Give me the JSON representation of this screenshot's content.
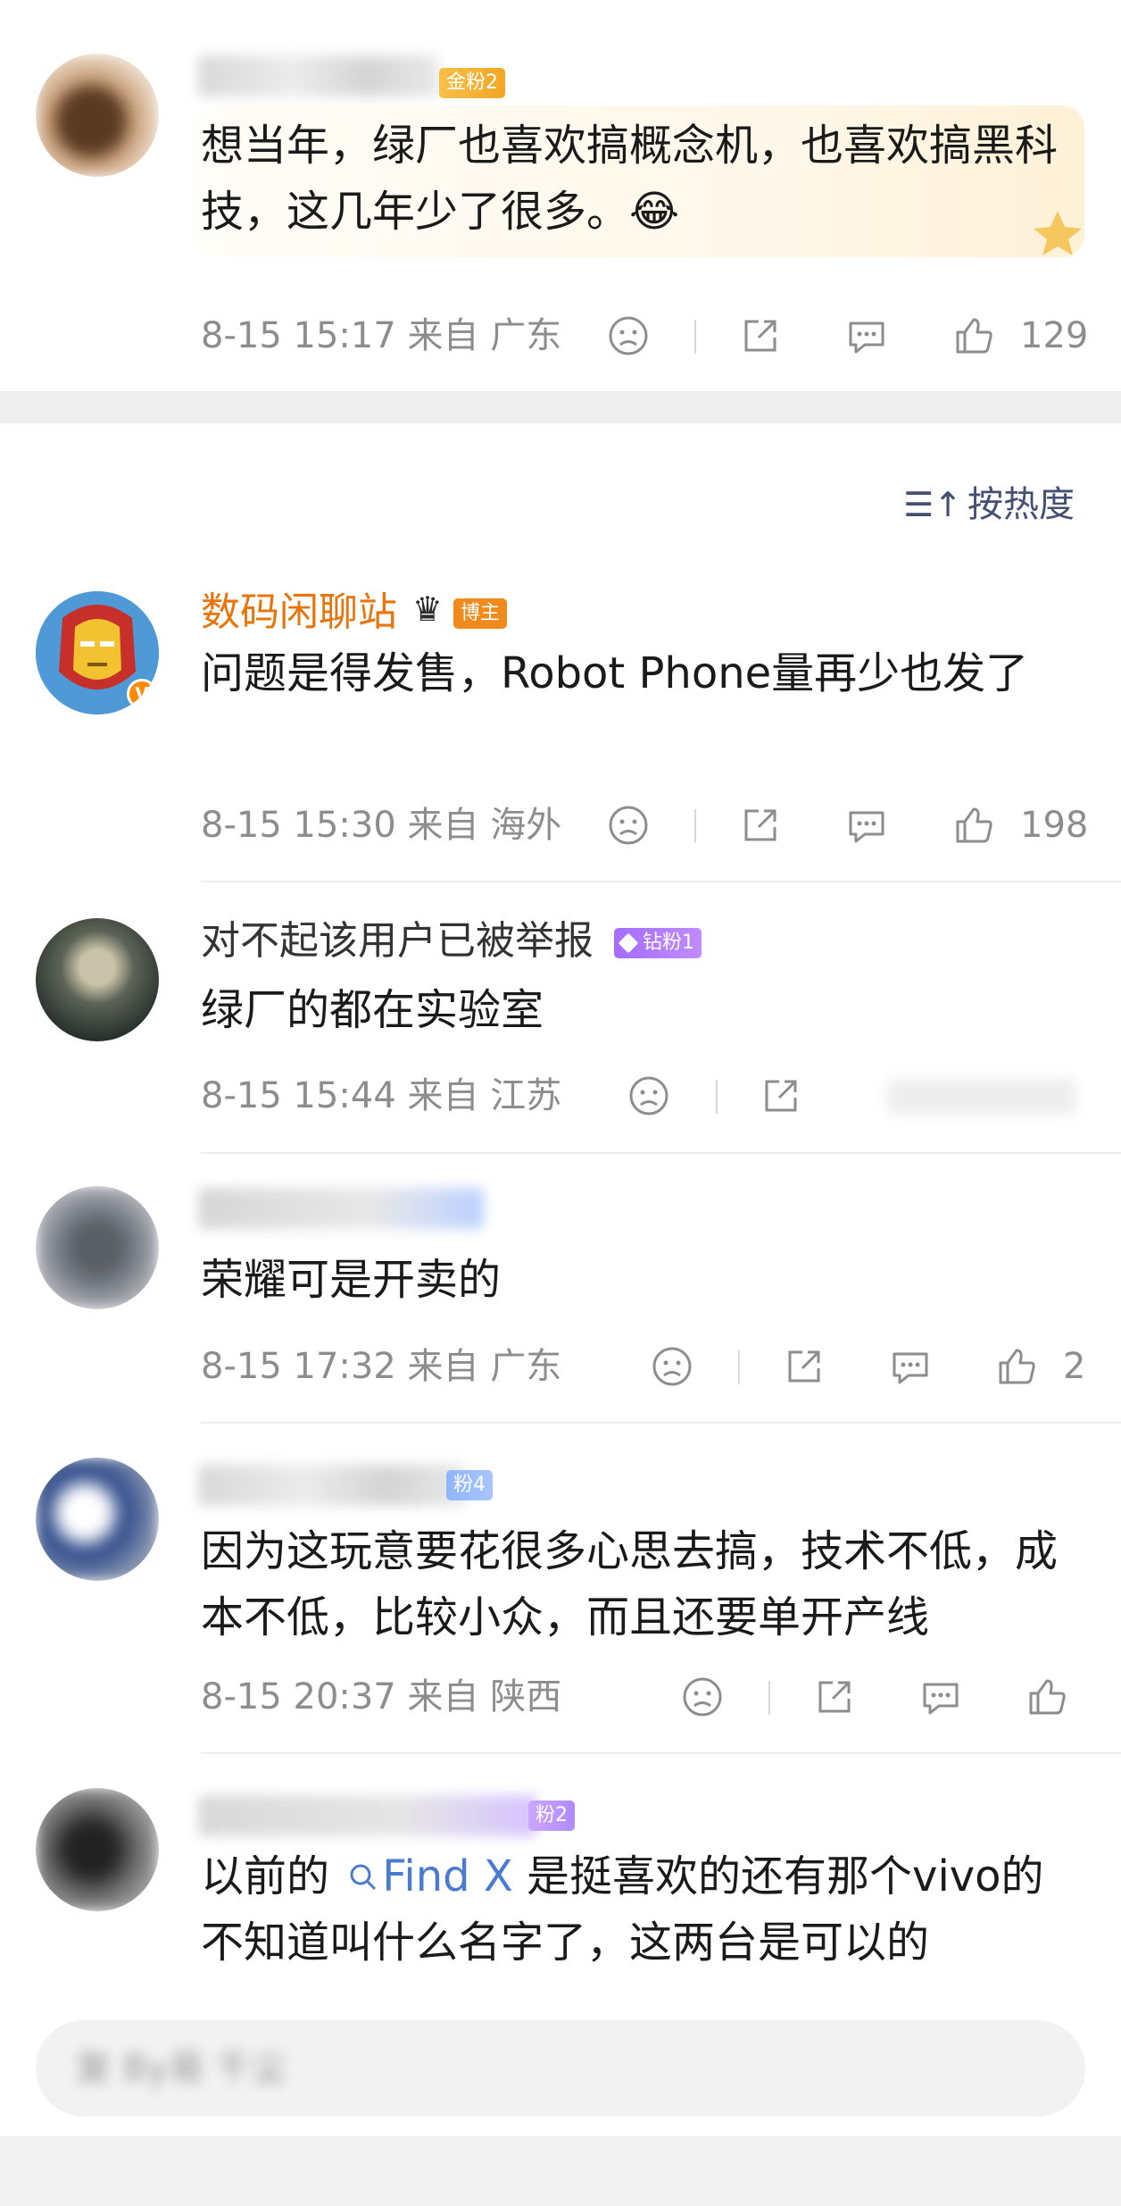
{
  "colors": {
    "accent_orange": "#e8740c",
    "link_blue": "#4a7bd0",
    "meta_grey": "#8d8d8d"
  },
  "sort": {
    "label": "按热度",
    "icon": "sort-lines-icon"
  },
  "comments": [
    {
      "badge": "金粉2",
      "content": "想当年，绿厂也喜欢搞概念机，也喜欢搞黑科技，这几年少了很多。😂",
      "time": "8-15 15:17 来自 广东",
      "likes": "129"
    },
    {
      "name": "数码闲聊站",
      "badge": "博主",
      "verified": "V",
      "content": "问题是得发售，Robot Phone量再少也发了",
      "time": "8-15 15:30 来自 海外",
      "likes": "198"
    },
    {
      "name": "对不起该用户已被举报",
      "badge": "钻粉1",
      "content": "绿厂的都在实验室",
      "time": "8-15 15:44 来自 江苏"
    },
    {
      "content": "荣耀可是开卖的",
      "time": "8-15 17:32 来自 广东",
      "likes": "2"
    },
    {
      "badge": "粉4",
      "content": "因为这玩意要花很多心思去搞，技术不低，成本不低，比较小众，而且还要单开产线",
      "time": "8-15 20:37 来自 陕西"
    },
    {
      "badge": "粉2",
      "content_before": "以前的",
      "link_text": "Find X",
      "content_after": "是挺喜欢的还有那个vivo的不知道叫什么名字了，这两台是可以的"
    }
  ],
  "reply_bar": {
    "placeholder": "复 By易 千尘"
  }
}
